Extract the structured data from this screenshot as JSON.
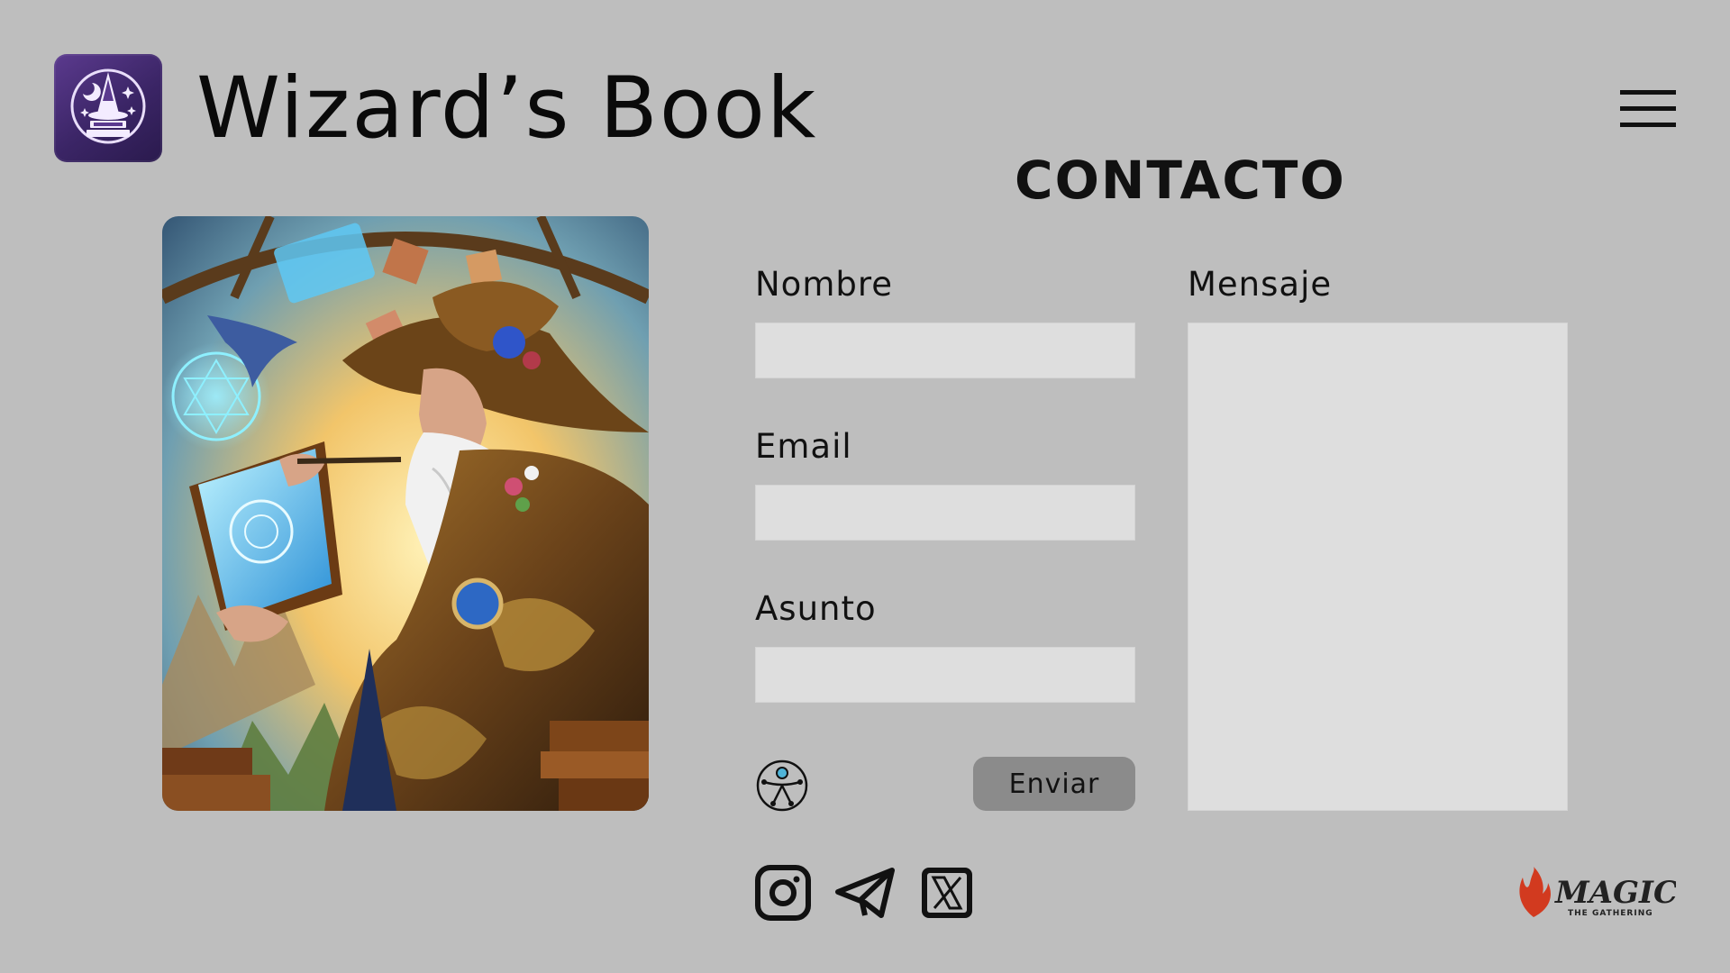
{
  "header": {
    "title": "Wizard’s Book",
    "logo_icon": "wizard-hat-book-logo",
    "menu_icon": "hamburger-menu-icon"
  },
  "contact": {
    "heading": "CONTACTO",
    "fields": {
      "name_label": "Nombre",
      "email_label": "Email",
      "subject_label": "Asunto",
      "message_label": "Mensaje",
      "name_value": "",
      "email_value": "",
      "subject_value": "",
      "message_value": ""
    },
    "send_label": "Enviar",
    "accessibility_icon": "accessibility-icon"
  },
  "hero": {
    "image": "wizard-writing-in-glowing-book-illustration"
  },
  "footer": {
    "social": [
      {
        "icon": "instagram-icon"
      },
      {
        "icon": "telegram-icon"
      },
      {
        "icon": "x-twitter-icon"
      }
    ],
    "brand": {
      "name": "MAGIC",
      "sub": "THE GATHERING"
    }
  },
  "colors": {
    "background": "#bebebe",
    "field": "#dedede",
    "button": "#8b8b8b",
    "logo": "#3b2566",
    "brand_red": "#d23a1f"
  }
}
